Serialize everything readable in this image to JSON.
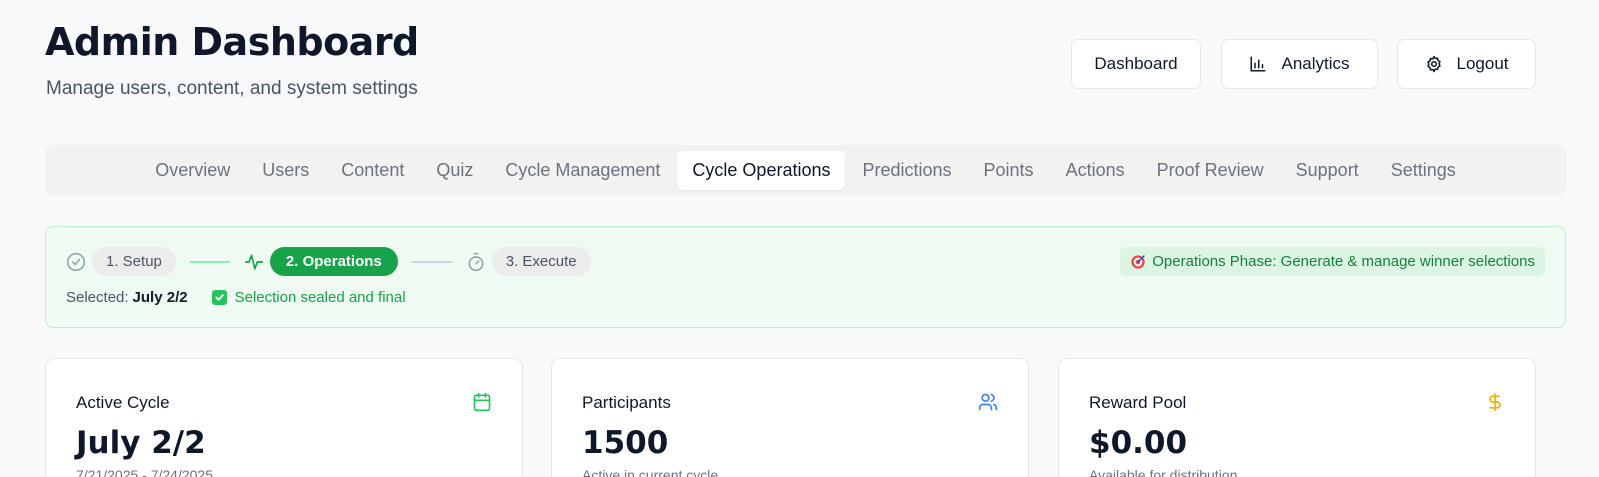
{
  "header": {
    "title": "Admin Dashboard",
    "subtitle": "Manage users, content, and system settings"
  },
  "top_buttons": {
    "dashboard": "Dashboard",
    "analytics": "Analytics",
    "analytics_icon": "bar-chart-icon",
    "logout": "Logout",
    "logout_icon": "gear-icon"
  },
  "tabs": [
    {
      "label": "Overview"
    },
    {
      "label": "Users"
    },
    {
      "label": "Content"
    },
    {
      "label": "Quiz"
    },
    {
      "label": "Cycle Management"
    },
    {
      "label": "Cycle Operations",
      "active": true
    },
    {
      "label": "Predictions"
    },
    {
      "label": "Points"
    },
    {
      "label": "Actions"
    },
    {
      "label": "Proof Review"
    },
    {
      "label": "Support"
    },
    {
      "label": "Settings"
    }
  ],
  "phase": {
    "steps": [
      {
        "label": "1. Setup",
        "icon": "check-circle-icon"
      },
      {
        "label": "2. Operations",
        "icon": "activity-icon"
      },
      {
        "label": "3. Execute",
        "icon": "timer-icon"
      }
    ],
    "selected_label": "Selected:",
    "selected_value": "July 2/2",
    "sealed_text": "Selection sealed and final",
    "badge_text": "Operations Phase: Generate & manage winner selections",
    "badge_icon": "target-icon",
    "colors": {
      "accent": "#16a34a",
      "background": "#effbf2",
      "border": "#bbf0cc"
    }
  },
  "cards": [
    {
      "title": "Active Cycle",
      "value": "July 2/2",
      "sub": "7/21/2025 - 7/24/2025",
      "icon": "calendar-icon",
      "icon_color": "#22c55e"
    },
    {
      "title": "Participants",
      "value": "1500",
      "sub": "Active in current cycle",
      "icon": "users-icon",
      "icon_color": "#3b82f6"
    },
    {
      "title": "Reward Pool",
      "value": "$0.00",
      "sub": "Available for distribution",
      "icon": "dollar-icon",
      "icon_color": "#eab308"
    }
  ]
}
